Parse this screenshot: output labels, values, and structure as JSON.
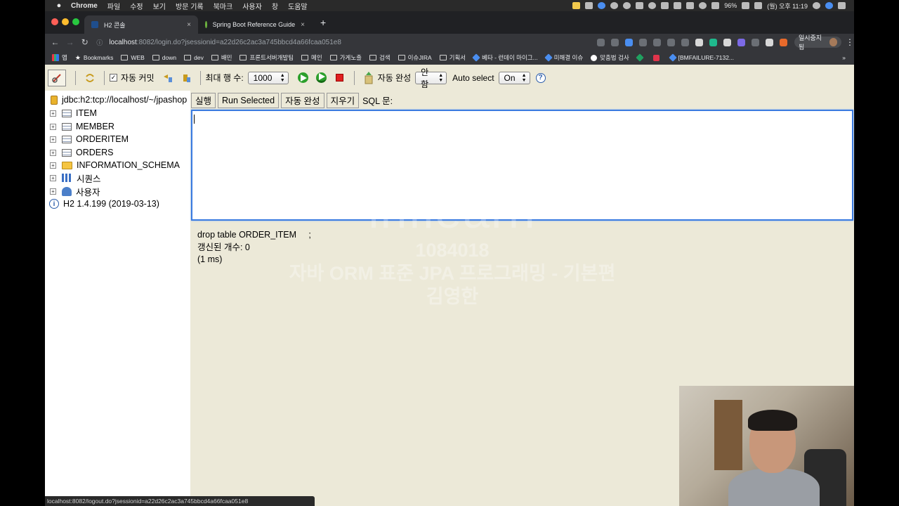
{
  "menubar": {
    "apple": "",
    "items": [
      "Chrome",
      "파일",
      "수정",
      "보기",
      "방문 기록",
      "북마크",
      "사용자",
      "창",
      "도움말"
    ],
    "battery": "96%",
    "clock": "(월) 오후 11:19"
  },
  "tabs": [
    {
      "title": "H2 콘솔",
      "close": "×"
    },
    {
      "title": "Spring Boot Reference Guide",
      "close": "×"
    }
  ],
  "newtab": "+",
  "address": {
    "host": "localhost",
    "path": ":8082/login.do?jsessionid=a22d26c2ac3a745bbcd4a66fcaa051e8"
  },
  "profile": {
    "label": "일시중지됨"
  },
  "bookmarks": [
    "앱",
    "Bookmarks",
    "WEB",
    "down",
    "dev",
    "배민",
    "프론트서버개발팀",
    "메인",
    "가게노출",
    "검색",
    "이슈JIRA",
    "기획서",
    "베타 - 런데이 마이그...",
    "미해결 이슈",
    "맞춤법 검사",
    "",
    "",
    "[BMFAILURE-7132..."
  ],
  "bookmarks_more": "»",
  "h2": {
    "autocommit_label": "자동 커밋",
    "autocommit_checked": true,
    "maxrows_label": "최대 행 수:",
    "maxrows_value": "1000",
    "autocomplete_label": "자동 완성",
    "autocomplete_value": "안함",
    "autoselect_label": "Auto select",
    "autoselect_value": "On",
    "help": "?"
  },
  "tree": {
    "connection": "jdbc:h2:tcp://localhost/~/jpashop",
    "tables": [
      "ITEM",
      "MEMBER",
      "ORDERITEM",
      "ORDERS"
    ],
    "schema": "INFORMATION_SCHEMA",
    "sequences": "시퀀스",
    "users": "사용자",
    "version": "H2 1.4.199 (2019-03-13)"
  },
  "query": {
    "run": "실행",
    "run_selected": "Run Selected",
    "autocomplete": "자동 완성",
    "clear": "지우기",
    "sql_label": "SQL 문:",
    "sql_text": ""
  },
  "result": {
    "line1": "drop table ORDER_ITEM     ;",
    "line2": "갱신된 개수: 0",
    "line3": "(1 ms)"
  },
  "watermark": {
    "logo": "inflearn",
    "id": "1084018",
    "course": "자바 ORM 표준 JPA 프로그래밍 - 기본편",
    "author": "김영한"
  },
  "status_url": "localhost:8082/logout.do?jsessionid=a22d26c2ac3a745bbcd4a66fcaa051e8"
}
